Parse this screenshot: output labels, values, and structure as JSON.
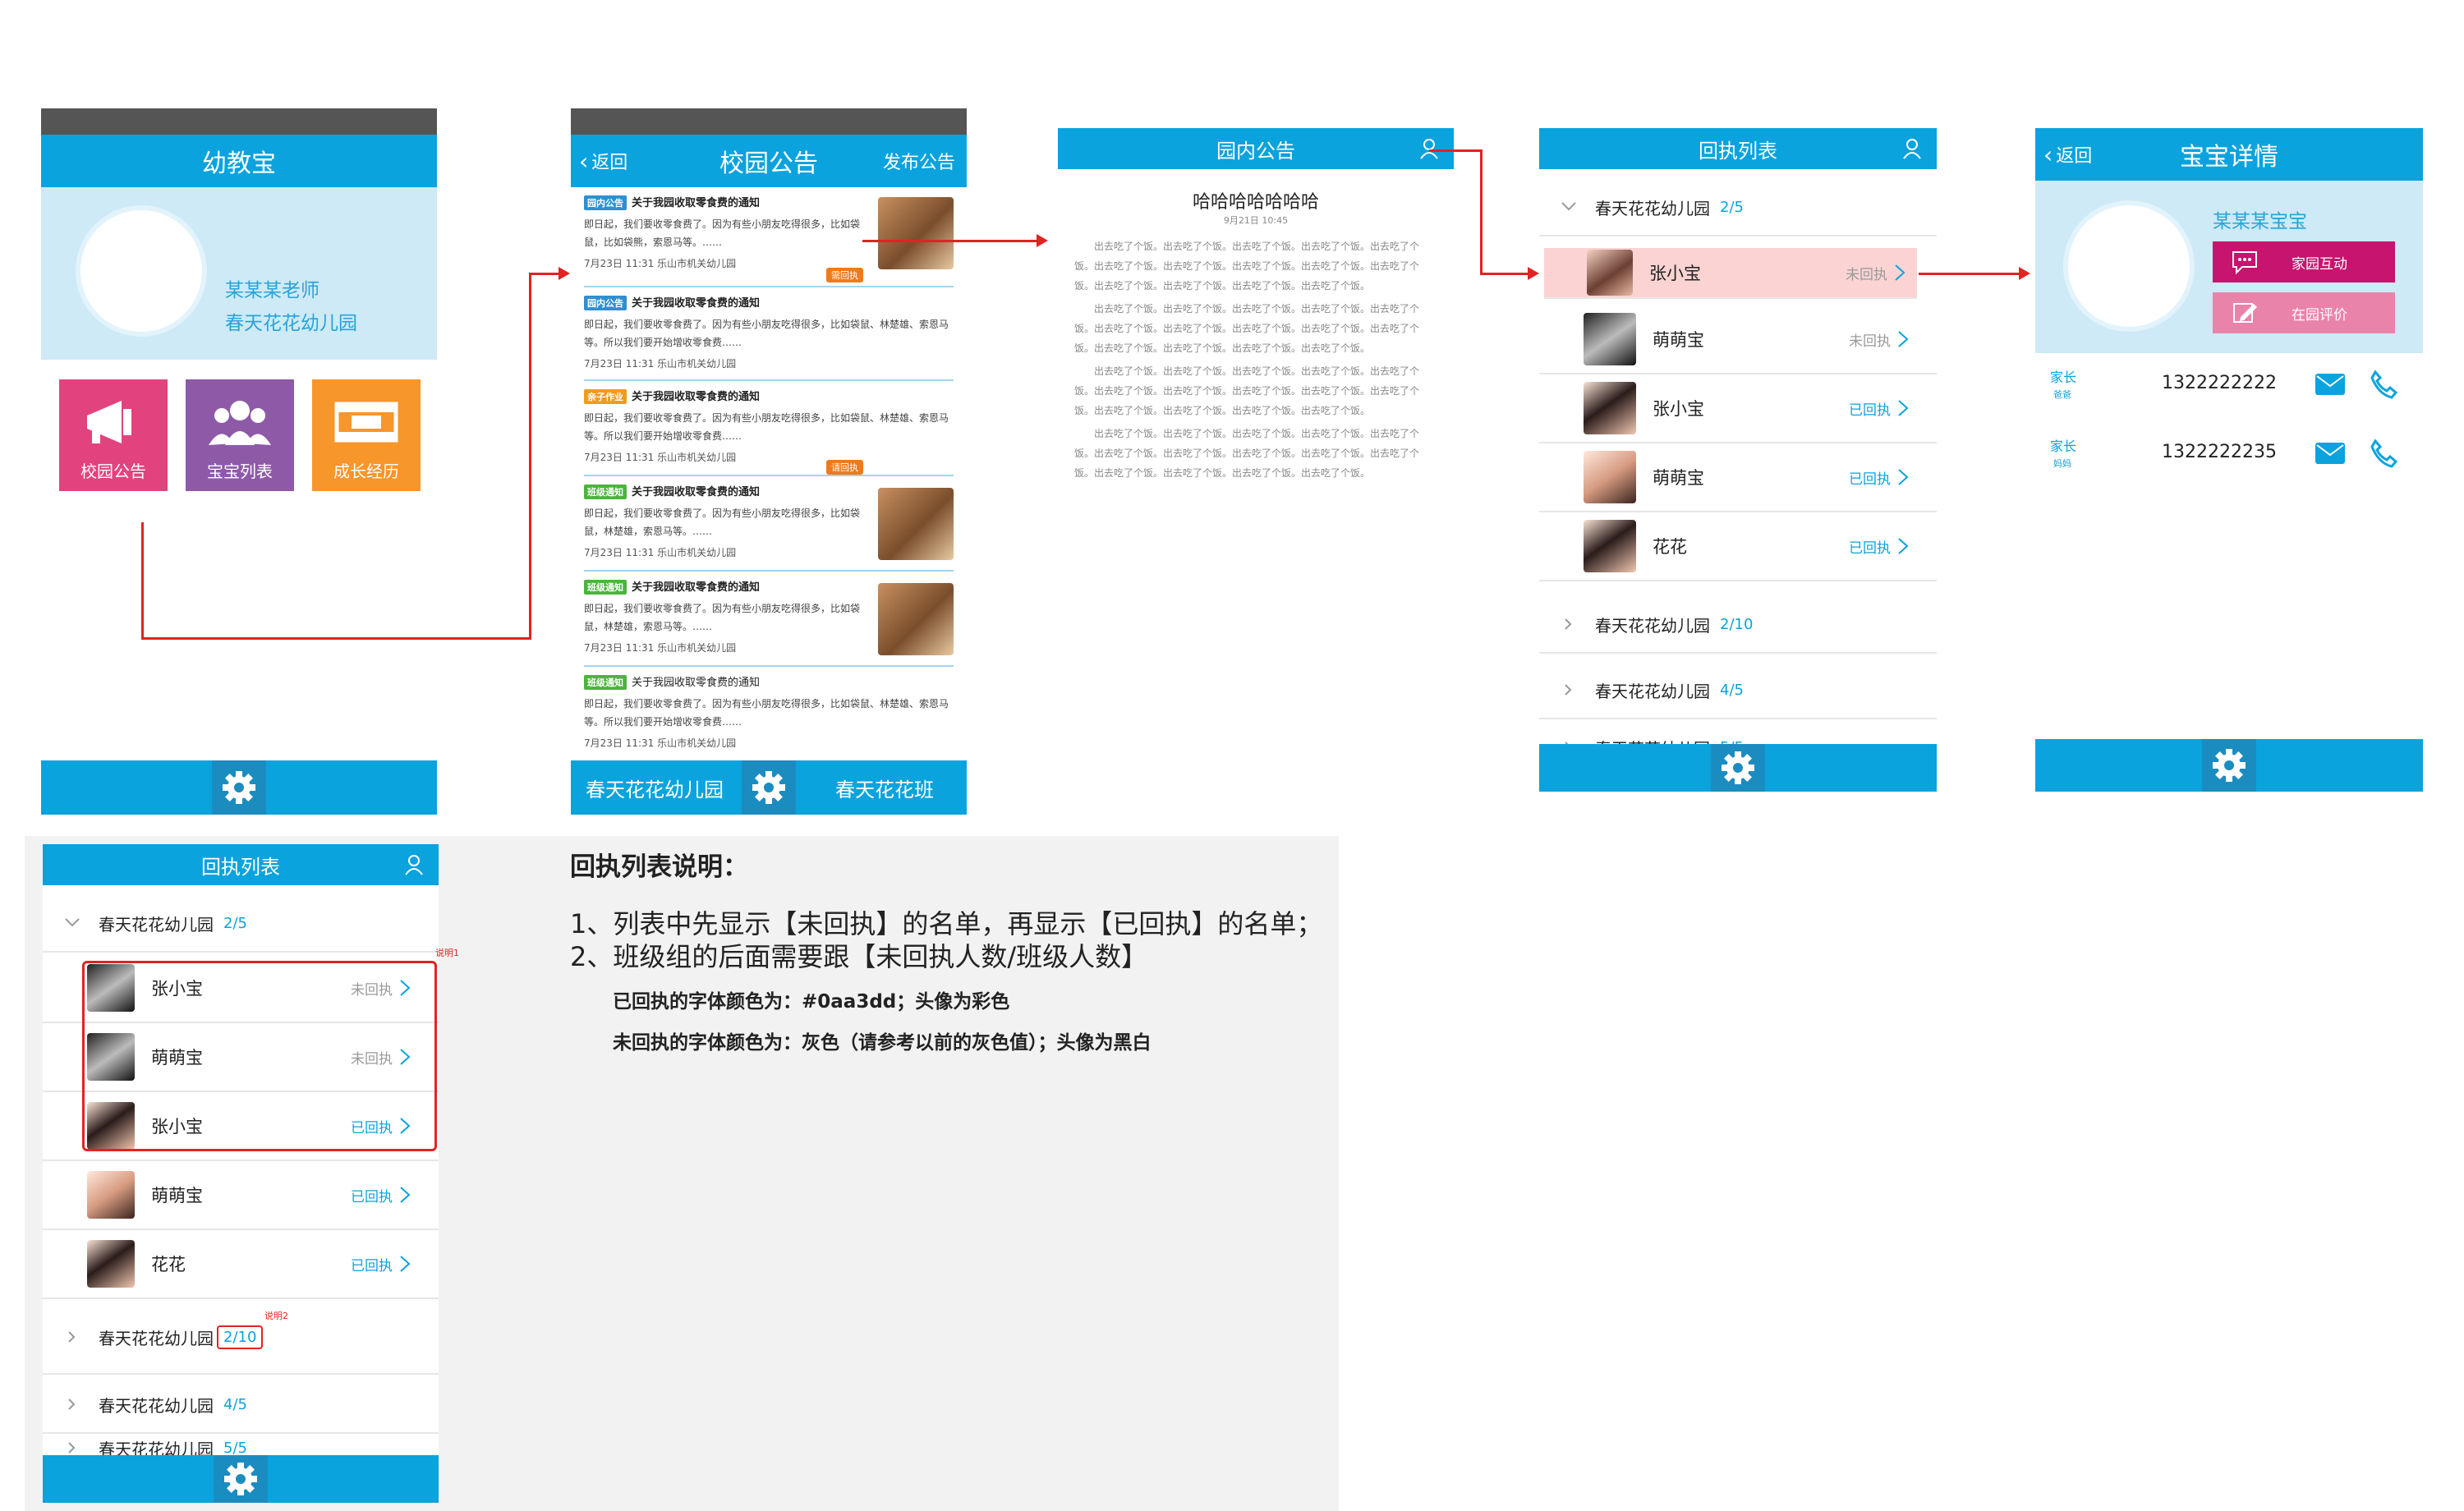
{
  "colors": {
    "blue": "#0aa3dd",
    "red": "#e32222",
    "pink": "#e2437f",
    "purple": "#8e5aa8",
    "orange": "#f7962a",
    "magenta": "#c7146f",
    "lightpink": "#ea83aa"
  },
  "home": {
    "title": "幼教宝",
    "teacher": "某某某老师",
    "school": "春天花花幼儿园",
    "tiles": [
      {
        "label": "校园公告",
        "icon": "megaphone-icon"
      },
      {
        "label": "宝宝列表",
        "icon": "people-icon"
      },
      {
        "label": "成长经历",
        "icon": "film-icon"
      }
    ]
  },
  "notices": {
    "back": "返回",
    "title": "校园公告",
    "action": "发布公告",
    "items": [
      {
        "tag": "园内公告",
        "title": "关于我园收取零食费的通知",
        "body": "即日起，我们要收零食费了。因为有些小朋友吃得很多，比如袋鼠，比如袋熊，索恩马等。……",
        "meta": "7月23日  11:31  乐山市机关幼儿园",
        "badge": "需回执"
      },
      {
        "tag": "园内公告",
        "title": "关于我园收取零食费的通知",
        "body": "即日起，我们要收零食费了。因为有些小朋友吃得很多，比如袋鼠、林楚雄、索恩马等。所以我们要开始增收零食费……",
        "meta": "7月23日  11:31  乐山市机关幼儿园",
        "badge": ""
      },
      {
        "tag": "亲子作业",
        "title": "关于我园收取零食费的通知",
        "body": "即日起，我们要收零食费了。因为有些小朋友吃得很多，比如袋鼠、林楚雄、索恩马等。所以我们要开始增收零食费……",
        "meta": "7月23日  11:31  乐山市机关幼儿园",
        "badge": "请回执"
      },
      {
        "tag": "班级通知",
        "title": "关于我园收取零食费的通知",
        "body": "即日起，我们要收零食费了。因为有些小朋友吃得很多，比如袋鼠，林楚雄，索恩马等。……",
        "meta": "7月23日  11:31  乐山市机关幼儿园",
        "badge": ""
      },
      {
        "tag": "班级通知",
        "title": "关于我园收取零食费的通知",
        "body": "即日起，我们要收零食费了。因为有些小朋友吃得很多，比如袋鼠，林楚雄，索恩马等。……",
        "meta": "7月23日  11:31  乐山市机关幼儿园",
        "badge": ""
      },
      {
        "tag": "班级通知",
        "title": "关于我园收取零食费的通知",
        "body": "即日起，我们要收零食费了。因为有些小朋友吃得很多，比如袋鼠、林楚雄、索恩马等。所以我们要开始增收零食费……",
        "meta": "7月23日  11:31  乐山市机关幼儿园",
        "badge": ""
      }
    ],
    "footer_left": "春天花花幼儿园",
    "footer_right": "春天花花班"
  },
  "article": {
    "bar": "园内公告",
    "title": "哈哈哈哈哈哈哈",
    "date": "9月21日  10:45",
    "para": "出去吃了个饭。出去吃了个饭。出去吃了个饭。出去吃了个饭。出去吃了个饭。出去吃了个饭。出去吃了个饭。出去吃了个饭。出去吃了个饭。出去吃了个饭。出去吃了个饭。出去吃了个饭。出去吃了个饭。出去吃了个饭。"
  },
  "receipt": {
    "title": "回执列表",
    "group1": {
      "name": "春天花花幼儿园",
      "count": "2/5"
    },
    "rows": [
      {
        "name": "张小宝",
        "status": "未回执"
      },
      {
        "name": "萌萌宝",
        "status": "未回执"
      },
      {
        "name": "张小宝",
        "status": "已回执"
      },
      {
        "name": "萌萌宝",
        "status": "已回执"
      },
      {
        "name": "花花",
        "status": "已回执"
      }
    ],
    "groups": [
      {
        "name": "春天花花幼儿园",
        "count": "2/10"
      },
      {
        "name": "春天花花幼儿园",
        "count": "4/5"
      },
      {
        "name": "春天花花幼儿园",
        "count": "5/5"
      }
    ]
  },
  "baby": {
    "back": "返回",
    "title": "宝宝详情",
    "name": "某某某宝宝",
    "btn1": "家园互动",
    "btn2": "在园评价",
    "contacts": [
      {
        "role": "家长",
        "rel": "爸爸",
        "phone": "1322222222"
      },
      {
        "role": "家长",
        "rel": "妈妈",
        "phone": "1322222235"
      }
    ]
  },
  "notes": {
    "title": "回执列表说明：",
    "line1": "1、列表中先显示【未回执】的名单，再显示【已回执】的名单；",
    "line2": "2、班级组的后面需要跟【未回执人数/班级人数】",
    "line3": "已回执的字体颜色为：#0aa3dd；头像为彩色",
    "line4": "未回执的字体颜色为：灰色（请参考以前的灰色值）；头像为黑白",
    "mark1": "说明1",
    "mark2": "说明2"
  }
}
